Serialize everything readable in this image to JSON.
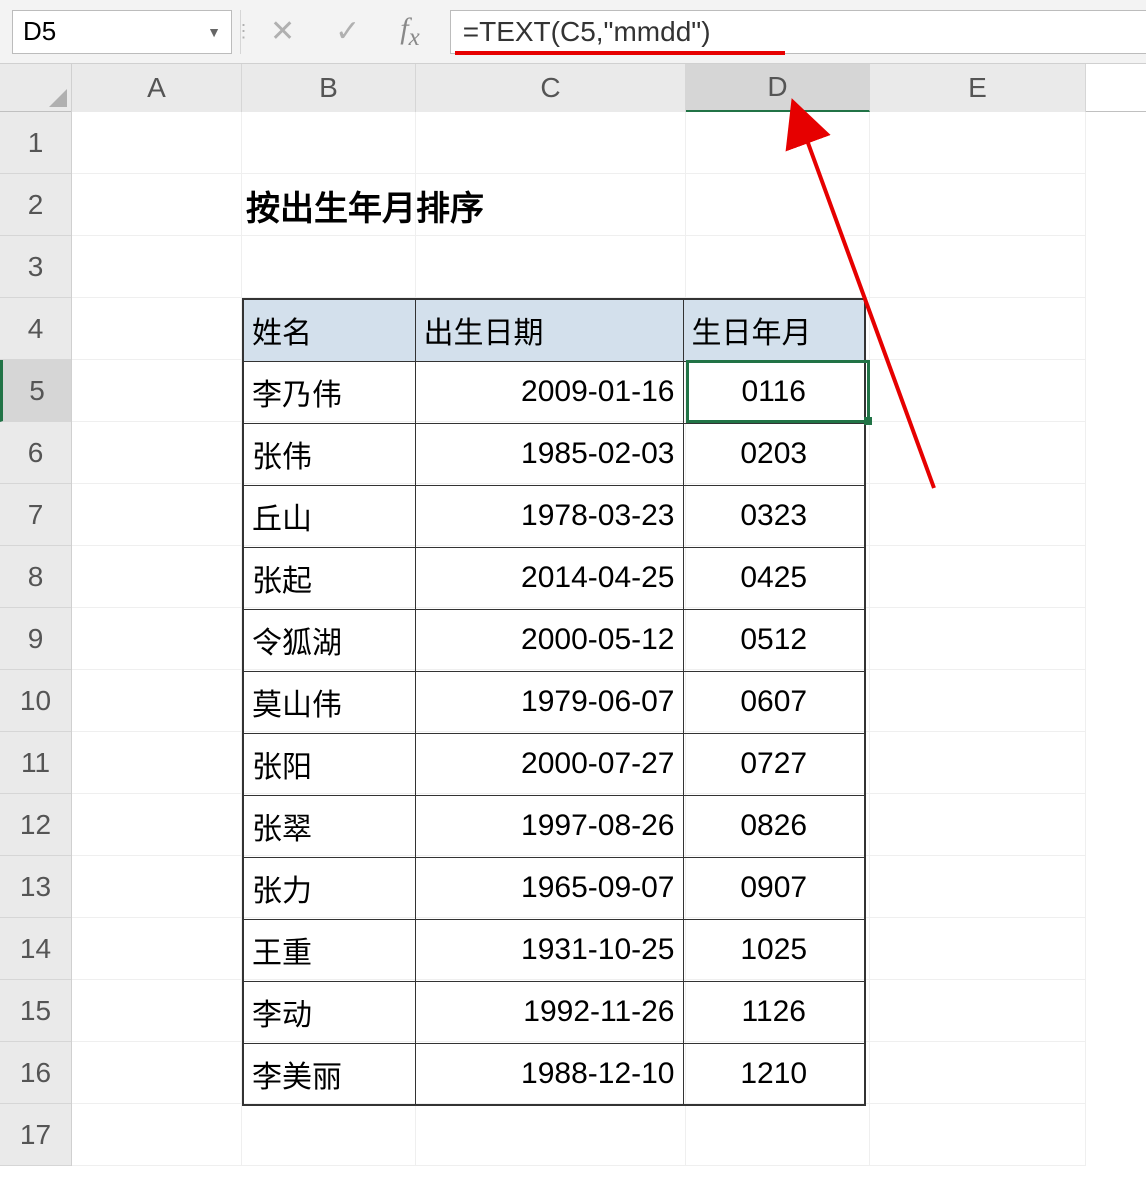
{
  "formulaBar": {
    "nameBox": "D5",
    "formula": "=TEXT(C5,\"mmdd\")"
  },
  "columns": [
    "A",
    "B",
    "C",
    "D",
    "E"
  ],
  "rowNumbers": [
    "1",
    "2",
    "3",
    "4",
    "5",
    "6",
    "7",
    "8",
    "9",
    "10",
    "11",
    "12",
    "13",
    "14",
    "15",
    "16",
    "17"
  ],
  "title": "按出生年月排序",
  "headers": {
    "name": "姓名",
    "dob": "出生日期",
    "mmdd": "生日年月"
  },
  "rows": [
    {
      "name": "李乃伟",
      "dob": "2009-01-16",
      "mmdd": "0116"
    },
    {
      "name": "张伟",
      "dob": "1985-02-03",
      "mmdd": "0203"
    },
    {
      "name": "丘山",
      "dob": "1978-03-23",
      "mmdd": "0323"
    },
    {
      "name": "张起",
      "dob": "2014-04-25",
      "mmdd": "0425"
    },
    {
      "name": "令狐湖",
      "dob": "2000-05-12",
      "mmdd": "0512"
    },
    {
      "name": "莫山伟",
      "dob": "1979-06-07",
      "mmdd": "0607"
    },
    {
      "name": "张阳",
      "dob": "2000-07-27",
      "mmdd": "0727"
    },
    {
      "name": "张翠",
      "dob": "1997-08-26",
      "mmdd": "0826"
    },
    {
      "name": "张力",
      "dob": "1965-09-07",
      "mmdd": "0907"
    },
    {
      "name": "王重",
      "dob": "1931-10-25",
      "mmdd": "1025"
    },
    {
      "name": "李动",
      "dob": "1992-11-26",
      "mmdd": "1126"
    },
    {
      "name": "李美丽",
      "dob": "1988-12-10",
      "mmdd": "1210"
    }
  ],
  "selectedCell": "D5",
  "selectedRow": 5,
  "selectedCol": "D"
}
